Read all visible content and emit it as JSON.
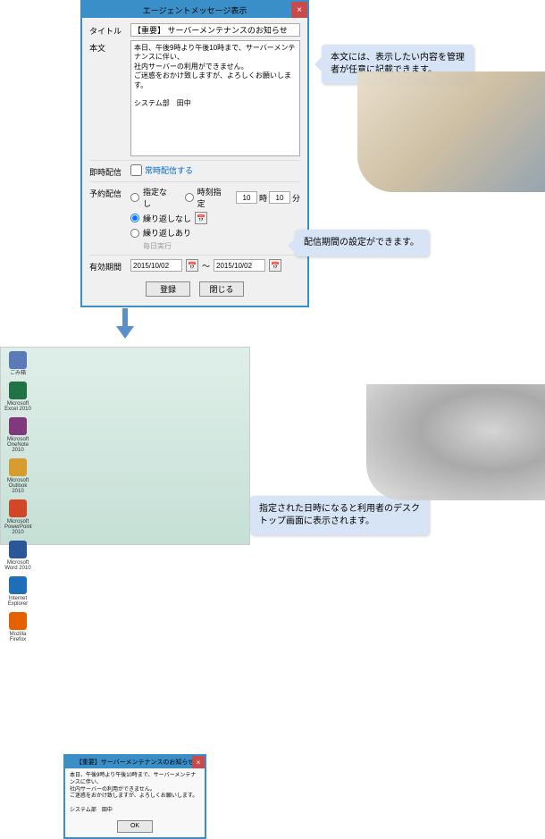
{
  "dialog1": {
    "title": "エージェントメッセージ表示",
    "close": "×",
    "labels": {
      "title_lbl": "タイトル",
      "body_lbl": "本文",
      "instant_lbl": "即時配信",
      "schedule_lbl": "予約配信",
      "period_lbl": "有効期間"
    },
    "title_value": "【重要】 サーバーメンテナンスのお知らせ",
    "body_value": "本日、午後9時より午後10時まで、サーバーメンテナンスに伴い、\n社内サーバーの利用ができません。\nご迷惑をおかけ致しますが、よろしくお願いします。\n\nシステム部　田中",
    "instant_chk": "常時配信する",
    "radio_none": "指定なし",
    "radio_time": "時刻指定",
    "time_h": "10",
    "time_h_u": "時",
    "time_m": "10",
    "time_m_u": "分",
    "radio_norepeat": "繰り返しなし",
    "radio_repeat": "繰り返しあり",
    "repeat_sub": "毎日実行",
    "date_from": "2015/10/02",
    "date_sep": "～",
    "date_to": "2015/10/02",
    "btn_register": "登録",
    "btn_close": "閉じる"
  },
  "callouts": {
    "c1": "本文には、表示したい内容を管理者が任意に記載できます。",
    "c2": "配信期間の設定ができます。",
    "c3": "指定された日時になると利用者のデスクトップ画面に表示されます。"
  },
  "desktop_icons": [
    {
      "label": "ごみ箱",
      "cls": "ico-re"
    },
    {
      "label": "Microsoft Excel 2010",
      "cls": "ico-excel"
    },
    {
      "label": "Microsoft OneNote 2010",
      "cls": "ico-on"
    },
    {
      "label": "Microsoft Outlook 2010",
      "cls": "ico-ol"
    },
    {
      "label": "Microsoft PowerPoint 2010",
      "cls": "ico-pp"
    },
    {
      "label": "Microsoft Word 2010",
      "cls": "ico-wd"
    },
    {
      "label": "Internet Explorer",
      "cls": "ico-ie"
    },
    {
      "label": "Mozilla Firefox",
      "cls": "ico-ff"
    }
  ],
  "dialog2": {
    "title": "【重要】サーバーメンテナンスのお知らせ",
    "close": "×",
    "body": "本日、午後9時より午後10時まで、サーバーメンテナンスに伴い、\n社内サーバーの利用ができません。\nご迷惑をおかけ致しますが、よろしくお願いします。\n\nシステム部　田中",
    "ok": "OK"
  }
}
